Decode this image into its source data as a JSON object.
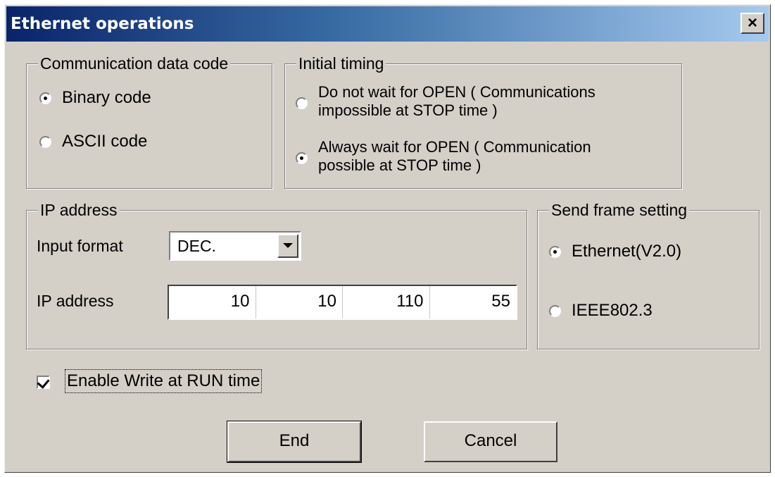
{
  "window": {
    "title": "Ethernet operations",
    "close_glyph": "×",
    "title_gradient": [
      "#0a246a",
      "#a6caf0"
    ],
    "background": "#d4d0c8"
  },
  "communication_data_code": {
    "legend": "Communication data code",
    "options": [
      {
        "label": "Binary code",
        "selected": true
      },
      {
        "label": "ASCII code",
        "selected": false
      }
    ]
  },
  "initial_timing": {
    "legend": "Initial timing",
    "options": [
      {
        "line1": "Do not wait for OPEN ( Communications",
        "line2": "impossible at STOP time )",
        "selected": false
      },
      {
        "line1": "Always wait for OPEN ( Communication",
        "line2": "possible at STOP time )",
        "selected": true
      }
    ]
  },
  "ip_address": {
    "legend": "IP address",
    "input_format_label": "Input format",
    "input_format_value": "DEC.",
    "ip_label": "IP address",
    "octets": [
      "10",
      "10",
      "110",
      "55"
    ]
  },
  "send_frame": {
    "legend": "Send frame setting",
    "options": [
      {
        "label": "Ethernet(V2.0)",
        "selected": true
      },
      {
        "label": "IEEE802.3",
        "selected": false
      }
    ]
  },
  "enable_write": {
    "label": "Enable Write at RUN time",
    "checked": true
  },
  "buttons": {
    "end": "End",
    "cancel": "Cancel"
  }
}
